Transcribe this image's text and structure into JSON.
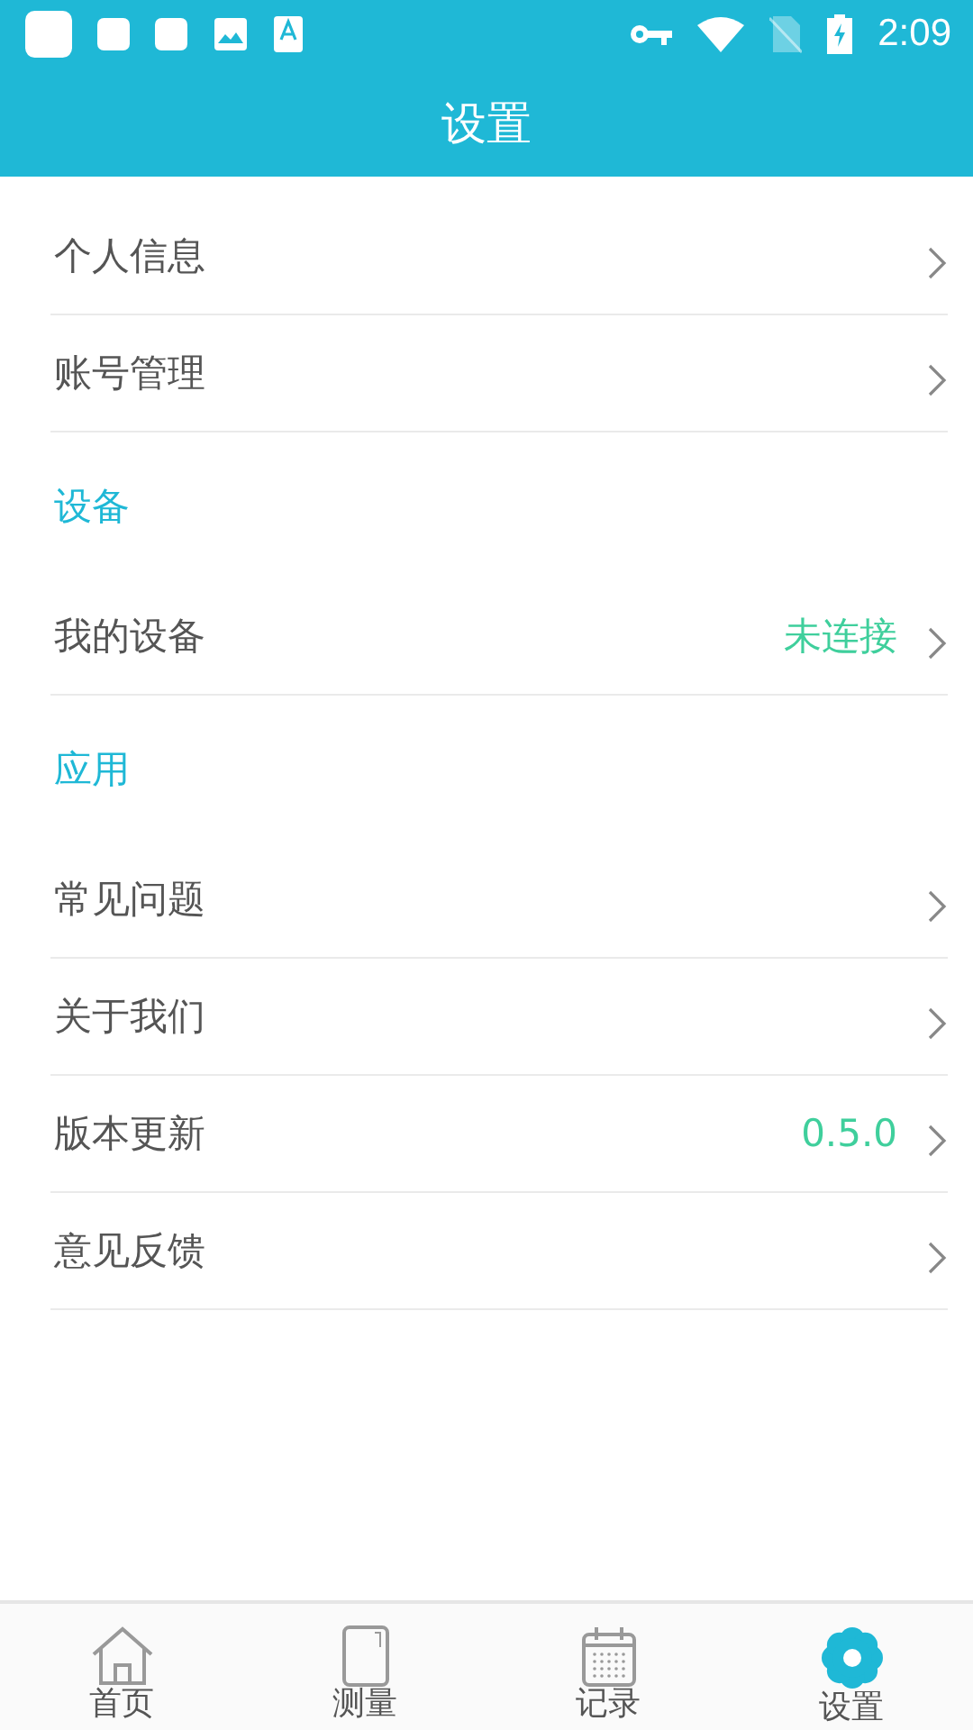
{
  "status_bar": {
    "time": "2:09"
  },
  "header": {
    "title": "设置"
  },
  "groups": [
    {
      "items": [
        {
          "label": "个人信息"
        },
        {
          "label": "账号管理"
        }
      ]
    },
    {
      "heading": "设备",
      "items": [
        {
          "label": "我的设备",
          "value": "未连接"
        }
      ]
    },
    {
      "heading": "应用",
      "items": [
        {
          "label": "常见问题"
        },
        {
          "label": "关于我们"
        },
        {
          "label": "版本更新",
          "value": "0.5.0"
        },
        {
          "label": "意见反馈"
        }
      ]
    }
  ],
  "bottom_nav": [
    {
      "kind": "home",
      "label": "首页",
      "selected": false
    },
    {
      "kind": "measure",
      "label": "测量",
      "selected": false
    },
    {
      "kind": "records",
      "label": "记录",
      "selected": false
    },
    {
      "kind": "settings",
      "label": "设置",
      "selected": true
    }
  ]
}
